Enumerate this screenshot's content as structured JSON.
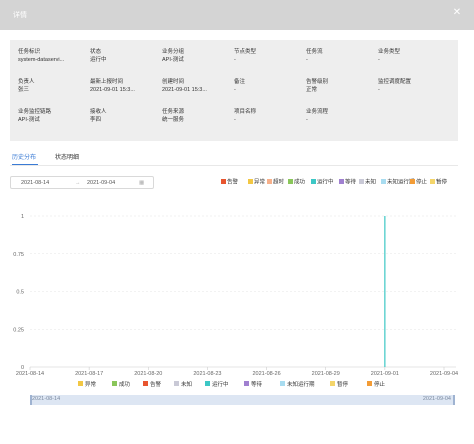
{
  "window": {
    "title": "详情",
    "close_icon": "close-icon"
  },
  "info": {
    "rows": [
      [
        {
          "label": "任务标识",
          "value": "system-dataservi..."
        },
        {
          "label": "状态",
          "value": "运行中"
        },
        {
          "label": "业务分组",
          "value": "API-测试"
        },
        {
          "label": "节点类型",
          "value": "-"
        },
        {
          "label": "任务流",
          "value": "-"
        },
        {
          "label": "业务类型",
          "value": "-"
        }
      ],
      [
        {
          "label": "负责人",
          "value": "张三"
        },
        {
          "label": "最新上报时间",
          "value": "2021-09-01 15:3..."
        },
        {
          "label": "创建时间",
          "value": "2021-09-01 15:3..."
        },
        {
          "label": "备注",
          "value": "-"
        },
        {
          "label": "告警级别",
          "value": "正常"
        },
        {
          "label": "监控调度配置",
          "value": "-"
        }
      ],
      [
        {
          "label": "业务监控链路",
          "value": "API-测试"
        },
        {
          "label": "接收人",
          "value": "李四"
        },
        {
          "label": "任务来源",
          "value": "统一服务"
        },
        {
          "label": "项目名称",
          "value": "-"
        },
        {
          "label": "业务流程",
          "value": "-"
        }
      ]
    ]
  },
  "tabs": [
    {
      "label": "历史分布",
      "active": true
    },
    {
      "label": "状态明细",
      "active": false
    }
  ],
  "daterange": {
    "start": "2021-08-14",
    "arrow": "→",
    "end": "2021-09-04",
    "icon": "calendar-icon"
  },
  "legend_top": [
    {
      "label": "告警",
      "color": "#e8552f"
    },
    {
      "label": "异常",
      "color": "#f2c744"
    },
    {
      "label": "超时",
      "color": "#f7b08a"
    },
    {
      "label": "成功",
      "color": "#8ac65a"
    },
    {
      "label": "运行中",
      "color": "#3cc7c5"
    },
    {
      "label": "等待",
      "color": "#a080d0"
    },
    {
      "label": "未知",
      "color": "#c9c9d6"
    },
    {
      "label": "未知运行期",
      "color": "#a8dcf0"
    },
    {
      "label": "停止",
      "color": "#f39c36"
    },
    {
      "label": "暂停",
      "color": "#f4d56a"
    }
  ],
  "legend_bottom": [
    {
      "label": "异常",
      "color": "#f2c744"
    },
    {
      "label": "成功",
      "color": "#8ac65a"
    },
    {
      "label": "告警",
      "color": "#e8552f"
    },
    {
      "label": "未知",
      "color": "#c9c9d6"
    },
    {
      "label": "运行中",
      "color": "#3cc7c5"
    },
    {
      "label": "等待",
      "color": "#a080d0"
    },
    {
      "label": "未知运行期",
      "color": "#a8dcf0"
    },
    {
      "label": "暂停",
      "color": "#f4d56a"
    },
    {
      "label": "停止",
      "color": "#f39c36"
    }
  ],
  "chart_data": {
    "type": "bar",
    "x": [
      "2021-08-14",
      "2021-08-15",
      "2021-08-16",
      "2021-08-17",
      "2021-08-18",
      "2021-08-19",
      "2021-08-20",
      "2021-08-21",
      "2021-08-22",
      "2021-08-23",
      "2021-08-24",
      "2021-08-25",
      "2021-08-26",
      "2021-08-27",
      "2021-08-28",
      "2021-08-29",
      "2021-08-30",
      "2021-08-31",
      "2021-09-01",
      "2021-09-02",
      "2021-09-03",
      "2021-09-04"
    ],
    "x_tick_labels": [
      "2021-08-14",
      "2021-08-17",
      "2021-08-20",
      "2021-08-23",
      "2021-08-26",
      "2021-08-29",
      "2021-09-01",
      "2021-09-04"
    ],
    "y_tick_labels": [
      "0",
      "0.25",
      "0.5",
      "0.75",
      "1"
    ],
    "ylim": [
      0,
      1
    ],
    "grid": "horizontal-dashed",
    "series": [
      {
        "name": "运行中",
        "color": "#3cc7c5",
        "values": [
          0,
          0,
          0,
          0,
          0,
          0,
          0,
          0,
          0,
          0,
          0,
          0,
          0,
          0,
          0,
          0,
          0,
          0,
          1,
          0,
          0,
          0
        ]
      }
    ],
    "slider": {
      "start": "2021-08-14",
      "end": "2021-09-04"
    }
  }
}
